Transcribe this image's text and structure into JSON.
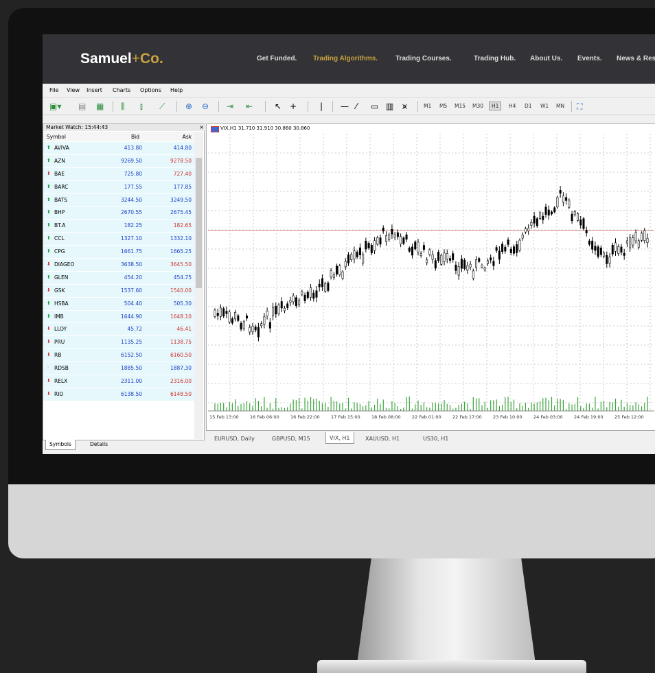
{
  "site": {
    "logo_main": "Samuel",
    "logo_plus": "+",
    "logo_co": "Co.",
    "nav": [
      "Get Funded.",
      "Trading Algorithms.",
      "Trading Courses.",
      "Trading Hub.",
      "About Us.",
      "Events.",
      "News & Res"
    ],
    "nav_active_index": 1,
    "accent_color": "#c9a23f"
  },
  "terminal": {
    "menu": [
      "File",
      "View",
      "Insert",
      "Charts",
      "Options",
      "Help"
    ],
    "timeframes": [
      "M1",
      "M5",
      "M15",
      "M30",
      "H1",
      "H4",
      "D1",
      "W1",
      "MN"
    ],
    "timeframe_selected": "H1",
    "market_watch": {
      "title": "Market Watch: 15:44:43",
      "columns": [
        "Symbol",
        "Bid",
        "Ask"
      ],
      "rows": [
        {
          "dir": "up",
          "symbol": "AVIVA",
          "bid": "413.80",
          "ask": "414.80"
        },
        {
          "dir": "up",
          "symbol": "AZN",
          "bid": "9269.50",
          "ask": "9278.50",
          "ask_dir": "down"
        },
        {
          "dir": "down",
          "symbol": "BAE",
          "bid": "725.80",
          "ask": "727.40"
        },
        {
          "dir": "up",
          "symbol": "BARC",
          "bid": "177.55",
          "ask": "177.85"
        },
        {
          "dir": "up",
          "symbol": "BATS",
          "bid": "3244.50",
          "ask": "3249.50"
        },
        {
          "dir": "up",
          "symbol": "BHP",
          "bid": "2670.55",
          "ask": "2675.45"
        },
        {
          "dir": "up",
          "symbol": "BT.A",
          "bid": "182.25",
          "ask": "182.65",
          "ask_dir": "down"
        },
        {
          "dir": "up",
          "symbol": "CCL",
          "bid": "1327.10",
          "ask": "1332.10"
        },
        {
          "dir": "up",
          "symbol": "CPG",
          "bid": "1661.75",
          "ask": "1665.25"
        },
        {
          "dir": "down",
          "symbol": "DIAGEO",
          "bid": "3638.50",
          "ask": "3645.50"
        },
        {
          "dir": "up",
          "symbol": "GLEN",
          "bid": "454.20",
          "ask": "454.75"
        },
        {
          "dir": "down",
          "symbol": "GSK",
          "bid": "1537.60",
          "ask": "1540.00"
        },
        {
          "dir": "up",
          "symbol": "HSBA",
          "bid": "504.40",
          "ask": "505.30"
        },
        {
          "dir": "up",
          "symbol": "IMB",
          "bid": "1644.90",
          "ask": "1648.10",
          "ask_dir": "down"
        },
        {
          "dir": "down",
          "symbol": "LLOY",
          "bid": "45.72",
          "ask": "46.41"
        },
        {
          "dir": "down",
          "symbol": "PRU",
          "bid": "1135.25",
          "ask": "1138.75"
        },
        {
          "dir": "down",
          "symbol": "RB",
          "bid": "6152.50",
          "ask": "6160.50"
        },
        {
          "dir": "neu",
          "symbol": "RDSB",
          "bid": "1885.50",
          "ask": "1887.30",
          "ask_dir": "up"
        },
        {
          "dir": "down",
          "symbol": "RELX",
          "bid": "2311.00",
          "ask": "2316.00"
        },
        {
          "dir": "down",
          "symbol": "RIO",
          "bid": "6138.50",
          "ask": "6148.50"
        }
      ],
      "tabs": [
        "Symbols",
        "Details"
      ]
    },
    "chart": {
      "header": "VIX,H1  31.710 31.910 30.860 30.860",
      "time_labels": [
        "15 Feb 13:00",
        "16 Feb 06:00",
        "16 Feb 22:00",
        "17 Feb 15:00",
        "18 Feb 08:00",
        "22 Feb 01:00",
        "22 Feb 17:00",
        "23 Feb 10:00",
        "24 Feb 03:00",
        "24 Feb 19:00",
        "25 Feb 12:00"
      ],
      "tabs": [
        "EURUSD, Daily",
        "GBPUSD, M15",
        "VIX, H1",
        "XAUUSD, H1",
        "US30, H1"
      ],
      "tab_selected": "VIX, H1"
    }
  },
  "chart_data": {
    "type": "line",
    "title": "VIX,H1",
    "x": [
      "15 Feb 13:00",
      "16 Feb 06:00",
      "16 Feb 22:00",
      "17 Feb 15:00",
      "18 Feb 08:00",
      "22 Feb 01:00",
      "22 Feb 17:00",
      "23 Feb 10:00",
      "24 Feb 03:00",
      "24 Feb 19:00",
      "25 Feb 12:00"
    ],
    "series": [
      {
        "values": [
          0.28,
          0.22,
          0.35,
          0.5,
          0.68,
          0.55,
          0.5,
          0.62,
          0.85,
          0.55,
          0.65
        ]
      }
    ],
    "ylim": [
      0,
      1
    ],
    "grid": true
  }
}
